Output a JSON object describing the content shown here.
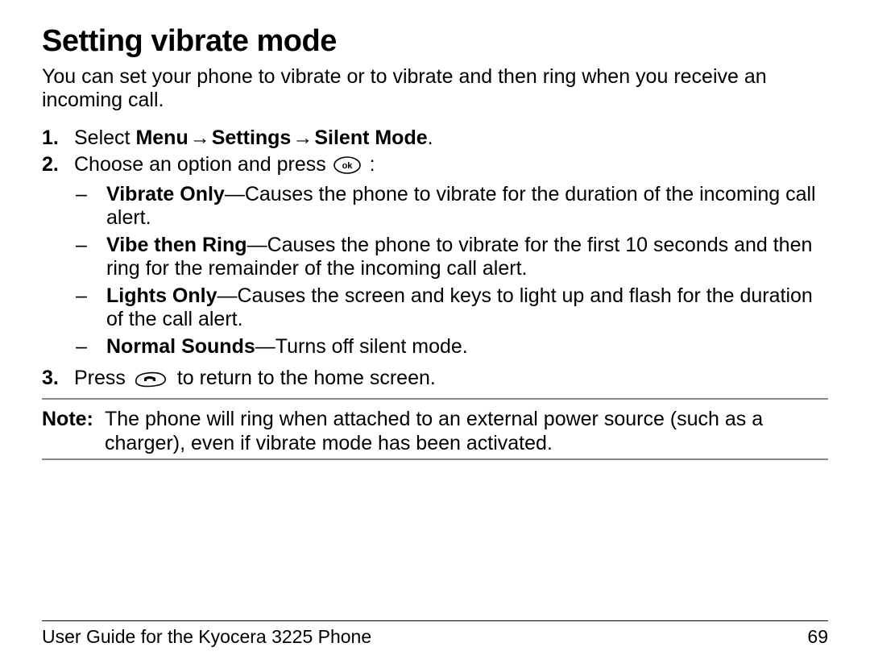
{
  "title": "Setting vibrate mode",
  "intro": "You can set your phone to vibrate or to vibrate and then ring when you receive an incoming call.",
  "steps": [
    {
      "num": "1.",
      "prefix": "Select ",
      "bold_path": [
        "Menu",
        "Settings",
        "Silent Mode"
      ],
      "suffix": "."
    },
    {
      "num": "2.",
      "text_before": "Choose an option and press ",
      "icon": "ok",
      "text_after": " :",
      "sub": [
        {
          "bold": "Vibrate Only",
          "desc": "—Causes the phone to vibrate for the duration of the incoming call alert."
        },
        {
          "bold": "Vibe then Ring",
          "desc": "—Causes the phone to vibrate for the first 10 seconds and then ring for the remainder of the incoming call alert."
        },
        {
          "bold": "Lights Only",
          "desc": "—Causes the screen and keys to light up and flash for the duration of the call alert."
        },
        {
          "bold": "Normal Sounds",
          "desc": "—Turns off silent mode."
        }
      ]
    },
    {
      "num": "3.",
      "text_before": "Press ",
      "icon": "end",
      "text_after": " to return to the home screen."
    }
  ],
  "note": {
    "label": "Note:",
    "text": "The phone will ring when attached to an external power source (such as a charger), even if vibrate mode has been activated."
  },
  "footer": {
    "guide": "User Guide for the Kyocera 3225 Phone",
    "page": "69"
  },
  "glyphs": {
    "arrow": "→",
    "dash": "–"
  }
}
